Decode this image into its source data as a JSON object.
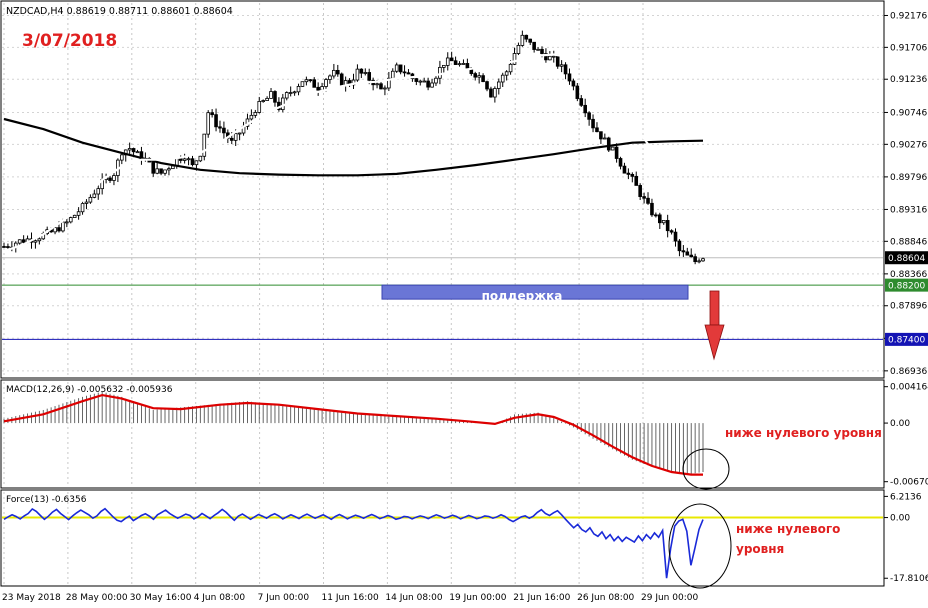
{
  "chart_data": [
    {
      "type": "candlestick",
      "symbol_header": "NZDCAD,H4  0.88619 0.88711 0.88601 0.88604",
      "annotation_date": "3/07/2018",
      "support_label": "поддержка",
      "ylim": [
        0.8686,
        0.9236
      ],
      "y_ticks": [
        "0.92176",
        "0.91706",
        "0.91236",
        "0.90746",
        "0.90276",
        "0.89796",
        "0.89316",
        "0.88846",
        "0.88366",
        "0.87896",
        "0.87416",
        "0.86936"
      ],
      "price_tags": {
        "current": "0.88604",
        "support": "0.88200",
        "target": "0.87400"
      },
      "horizontal_levels": {
        "current": 0.88604,
        "support": 0.882,
        "target": 0.874
      },
      "x_tick_labels": [
        "23 May 2018",
        "28 May 00:00",
        "30 May 16:00",
        "4 Jun 08:00",
        "7 Jun 00:00",
        "11 Jun 16:00",
        "14 Jun 08:00",
        "19 Jun 00:00",
        "21 Jun 16:00",
        "26 Jun 08:00",
        "29 Jun 00:00"
      ],
      "close_path": [
        [
          0,
          0.8877
        ],
        [
          4,
          0.8885
        ],
        [
          8,
          0.889
        ],
        [
          12,
          0.8898
        ],
        [
          16,
          0.8912
        ],
        [
          20,
          0.8935
        ],
        [
          24,
          0.8965
        ],
        [
          28,
          0.8985
        ],
        [
          30,
          0.9018
        ],
        [
          32,
          0.9022
        ],
        [
          34,
          0.9012
        ],
        [
          36,
          0.9005
        ],
        [
          38,
          0.899
        ],
        [
          40,
          0.8985
        ],
        [
          42,
          0.8995
        ],
        [
          44,
          0.9005
        ],
        [
          46,
          0.9012
        ],
        [
          48,
          0.8995
        ],
        [
          50,
          0.9015
        ],
        [
          52,
          0.9075
        ],
        [
          54,
          0.9058
        ],
        [
          56,
          0.9045
        ],
        [
          58,
          0.903
        ],
        [
          60,
          0.9045
        ],
        [
          62,
          0.9062
        ],
        [
          64,
          0.908
        ],
        [
          66,
          0.909
        ],
        [
          68,
          0.91
        ],
        [
          70,
          0.9082
        ],
        [
          72,
          0.91
        ],
        [
          74,
          0.911
        ],
        [
          76,
          0.9122
        ],
        [
          78,
          0.9118
        ],
        [
          80,
          0.9112
        ],
        [
          82,
          0.9125
        ],
        [
          84,
          0.9132
        ],
        [
          86,
          0.912
        ],
        [
          88,
          0.9118
        ],
        [
          90,
          0.9135
        ],
        [
          92,
          0.9128
        ],
        [
          94,
          0.912
        ],
        [
          96,
          0.9108
        ],
        [
          98,
          0.9122
        ],
        [
          100,
          0.914
        ],
        [
          102,
          0.9135
        ],
        [
          104,
          0.9125
        ],
        [
          106,
          0.912
        ],
        [
          108,
          0.9118
        ],
        [
          110,
          0.913
        ],
        [
          112,
          0.9148
        ],
        [
          114,
          0.915
        ],
        [
          116,
          0.9145
        ],
        [
          118,
          0.9138
        ],
        [
          120,
          0.9132
        ],
        [
          122,
          0.9125
        ],
        [
          124,
          0.9102
        ],
        [
          126,
          0.912
        ],
        [
          128,
          0.9135
        ],
        [
          130,
          0.9162
        ],
        [
          132,
          0.9185
        ],
        [
          134,
          0.9175
        ],
        [
          136,
          0.9165
        ],
        [
          138,
          0.9158
        ],
        [
          140,
          0.9152
        ],
        [
          142,
          0.914
        ],
        [
          144,
          0.9125
        ],
        [
          146,
          0.91
        ],
        [
          148,
          0.908
        ],
        [
          150,
          0.9055
        ],
        [
          152,
          0.904
        ],
        [
          154,
          0.9025
        ],
        [
          156,
          0.901
        ],
        [
          158,
          0.899
        ],
        [
          160,
          0.8975
        ],
        [
          162,
          0.8955
        ],
        [
          164,
          0.8935
        ],
        [
          166,
          0.892
        ],
        [
          168,
          0.891
        ],
        [
          170,
          0.8895
        ],
        [
          172,
          0.887
        ],
        [
          174,
          0.8862
        ],
        [
          176,
          0.8855
        ],
        [
          177,
          0.886
        ],
        [
          178,
          0.8862
        ]
      ],
      "ma_fast_path": [
        [
          0,
          0.887
        ],
        [
          5,
          0.888
        ],
        [
          10,
          0.8895
        ],
        [
          15,
          0.8915
        ],
        [
          20,
          0.8945
        ],
        [
          25,
          0.8975
        ],
        [
          30,
          0.8995
        ],
        [
          35,
          0.9005
        ],
        [
          40,
          0.9005
        ],
        [
          45,
          0.9008
        ],
        [
          50,
          0.9015
        ],
        [
          55,
          0.903
        ],
        [
          60,
          0.905
        ],
        [
          65,
          0.9068
        ],
        [
          70,
          0.9082
        ],
        [
          75,
          0.9095
        ],
        [
          80,
          0.9105
        ],
        [
          85,
          0.9112
        ],
        [
          90,
          0.9118
        ],
        [
          95,
          0.912
        ],
        [
          100,
          0.9125
        ],
        [
          105,
          0.9127
        ],
        [
          110,
          0.913
        ],
        [
          115,
          0.9135
        ],
        [
          120,
          0.914
        ],
        [
          125,
          0.9145
        ],
        [
          130,
          0.915
        ],
        [
          135,
          0.9158
        ],
        [
          140,
          0.916
        ],
        [
          145,
          0.9155
        ],
        [
          150,
          0.9135
        ],
        [
          155,
          0.91
        ],
        [
          160,
          0.906
        ],
        [
          165,
          0.902
        ],
        [
          170,
          0.8985
        ],
        [
          175,
          0.8945
        ],
        [
          178,
          0.8915
        ]
      ],
      "ma_slow_path": [
        [
          0,
          0.9065
        ],
        [
          10,
          0.905
        ],
        [
          20,
          0.903
        ],
        [
          30,
          0.9015
        ],
        [
          40,
          0.9
        ],
        [
          50,
          0.899
        ],
        [
          60,
          0.8985
        ],
        [
          70,
          0.8983
        ],
        [
          80,
          0.8982
        ],
        [
          90,
          0.8982
        ],
        [
          100,
          0.8984
        ],
        [
          110,
          0.899
        ],
        [
          120,
          0.8997
        ],
        [
          130,
          0.9005
        ],
        [
          140,
          0.9013
        ],
        [
          150,
          0.9022
        ],
        [
          160,
          0.903
        ],
        [
          170,
          0.9032
        ],
        [
          178,
          0.9033
        ]
      ]
    },
    {
      "type": "bar_line",
      "header": "MACD(12,26,9) -0.005632 -0.005936",
      "ylim": [
        -0.0072,
        0.0047
      ],
      "y_ticks": [
        "0.004164",
        "0.00",
        "-0.006707"
      ],
      "annotation": "ниже нулевого уровня",
      "histogram_path": [
        [
          0,
          0.0005
        ],
        [
          10,
          0.0015
        ],
        [
          20,
          0.003
        ],
        [
          25,
          0.0036
        ],
        [
          30,
          0.003
        ],
        [
          38,
          0.0015
        ],
        [
          45,
          0.0018
        ],
        [
          55,
          0.0022
        ],
        [
          62,
          0.0025
        ],
        [
          70,
          0.002
        ],
        [
          80,
          0.0015
        ],
        [
          90,
          0.001
        ],
        [
          100,
          0.0008
        ],
        [
          110,
          0.0006
        ],
        [
          118,
          0.0002
        ],
        [
          125,
          -0.0002
        ],
        [
          130,
          0.001
        ],
        [
          136,
          0.0012
        ],
        [
          140,
          0.0006
        ],
        [
          145,
          -0.0005
        ],
        [
          150,
          -0.0018
        ],
        [
          155,
          -0.003
        ],
        [
          160,
          -0.0042
        ],
        [
          165,
          -0.005
        ],
        [
          170,
          -0.0056
        ],
        [
          175,
          -0.0058
        ],
        [
          178,
          -0.0056
        ]
      ],
      "signal_path": [
        [
          0,
          0.0002
        ],
        [
          10,
          0.001
        ],
        [
          20,
          0.0025
        ],
        [
          25,
          0.0032
        ],
        [
          30,
          0.0028
        ],
        [
          38,
          0.0017
        ],
        [
          45,
          0.0016
        ],
        [
          55,
          0.0021
        ],
        [
          62,
          0.0023
        ],
        [
          70,
          0.0021
        ],
        [
          80,
          0.0016
        ],
        [
          90,
          0.0011
        ],
        [
          100,
          0.0008
        ],
        [
          110,
          0.0005
        ],
        [
          118,
          0.0002
        ],
        [
          125,
          -0.0001
        ],
        [
          130,
          0.0006
        ],
        [
          136,
          0.001
        ],
        [
          140,
          0.0007
        ],
        [
          145,
          -0.0002
        ],
        [
          150,
          -0.0014
        ],
        [
          155,
          -0.0027
        ],
        [
          160,
          -0.0039
        ],
        [
          165,
          -0.0049
        ],
        [
          170,
          -0.0056
        ],
        [
          175,
          -0.0059
        ],
        [
          178,
          -0.0059
        ]
      ]
    },
    {
      "type": "line",
      "header": "Force(13) -0.6356",
      "ylim": [
        -19.5,
        7.5
      ],
      "y_ticks": [
        "6.2136",
        "0.00",
        "-17.8106"
      ],
      "annotation_lines": [
        "ниже нулевого",
        "уровня"
      ],
      "values": [
        -0.5,
        0.2,
        0.8,
        0.3,
        -0.4,
        0.5,
        1.2,
        2.5,
        1.8,
        0.6,
        -0.5,
        0.4,
        1.6,
        2.4,
        1.2,
        0.3,
        -0.6,
        0.5,
        1.4,
        2.2,
        1.5,
        0.8,
        -0.2,
        0.5,
        1.8,
        2.6,
        1.4,
        0.2,
        -0.8,
        -1.2,
        -0.3,
        0.4,
        -0.9,
        -0.2,
        0.6,
        1.1,
        0.4,
        -0.5,
        0.8,
        1.5,
        2.2,
        1.2,
        0.5,
        -0.2,
        0.4,
        1.0,
        0.6,
        -0.4,
        0.2,
        1.2,
        0.5,
        -0.3,
        0.6,
        1.4,
        2.4,
        1.5,
        0.3,
        -0.8,
        0.4,
        1.0,
        0.3,
        -0.5,
        0.2,
        0.9,
        0.4,
        -0.2,
        0.6,
        1.1,
        0.5,
        -0.4,
        0.2,
        0.8,
        0.3,
        -0.3,
        0.5,
        1.0,
        0.4,
        -0.2,
        0.3,
        0.8,
        0.2,
        -0.5,
        0.3,
        0.9,
        0.3,
        -0.4,
        0.2,
        0.7,
        0.3,
        -0.2,
        0.4,
        0.9,
        0.4,
        -0.3,
        0.1,
        0.6,
        0.2,
        -0.5,
        -0.2,
        0.3,
        0.2,
        -0.4,
        0.1,
        0.5,
        0.2,
        -0.3,
        0.3,
        0.8,
        0.4,
        -0.2,
        0.2,
        0.7,
        0.3,
        -0.4,
        0.1,
        0.6,
        0.2,
        -0.3,
        0.0,
        0.5,
        0.3,
        -0.2,
        0.2,
        0.8,
        0.3,
        -0.6,
        -1.2,
        -0.5,
        0.2,
        0.5,
        -0.2,
        0.4,
        1.5,
        2.3,
        1.2,
        0.6,
        1.4,
        2.0,
        0.8,
        -0.5,
        -1.8,
        -3.0,
        -2.0,
        -3.5,
        -4.2,
        -3.0,
        -4.8,
        -5.5,
        -4.2,
        -6.2,
        -5.0,
        -6.8,
        -5.6,
        -7.0,
        -5.8,
        -6.5,
        -7.2,
        -5.4,
        -6.8,
        -5.0,
        -6.2,
        -4.5,
        -5.8,
        -3.8,
        -17.8,
        -9.0,
        -2.5,
        -1.0,
        -0.5,
        -4.0,
        -14.0,
        -9.0,
        -3.5,
        -0.6
      ]
    }
  ]
}
